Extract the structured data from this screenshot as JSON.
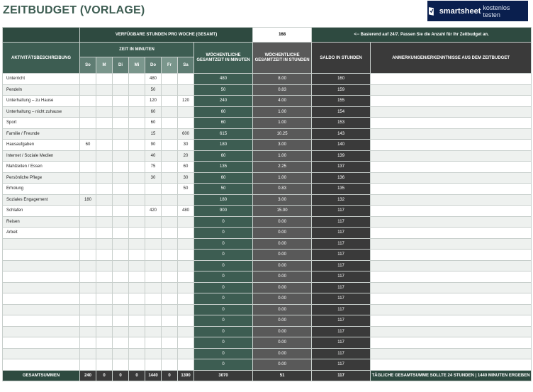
{
  "title": "ZEITBUDGET (VORLAGE)",
  "brand": {
    "name": "smartsheet",
    "cta": "kostenlos testen"
  },
  "header": {
    "available_hours_label": "VERFÜGBARE STUNDEN PRO WOCHE (GESAMT)",
    "available_hours_value": "168",
    "note": "<-- Basierend auf 24/7. Passen Sie die Anzahl für Ihr Zeitbudget an.",
    "activity_col": "AKTIVITÄTSBESCHREIBUNG",
    "minutes_group": "ZEIT IN MINUTEN",
    "days": [
      "So",
      "M",
      "Di",
      "Mi",
      "Do",
      "Fr",
      "Sa"
    ],
    "weekly_minutes": "WÖCHENTLICHE GESAMTZEIT IN MINUTEN",
    "weekly_hours": "WÖCHENTLICHE GESAMTZEIT IN STUNDEN",
    "balance": "SALDO IN STUNDEN",
    "notes_col": "ANMERKUNGEN/ERKENNTNISSE AUS DEM ZEITBUDGET"
  },
  "rows": [
    {
      "activity": "Unterricht",
      "days": [
        "",
        "",
        "",
        "",
        "480",
        "",
        ""
      ],
      "minutes": "480",
      "hours": "8.00",
      "balance": "160"
    },
    {
      "activity": "Pendeln",
      "days": [
        "",
        "",
        "",
        "",
        "50",
        "",
        ""
      ],
      "minutes": "50",
      "hours": "0.83",
      "balance": "159"
    },
    {
      "activity": "Unterhaltung – zu Hause",
      "days": [
        "",
        "",
        "",
        "",
        "120",
        "",
        "120"
      ],
      "minutes": "240",
      "hours": "4.00",
      "balance": "155"
    },
    {
      "activity": "Unterhaltung – nicht zuhause",
      "days": [
        "",
        "",
        "",
        "",
        "60",
        "",
        ""
      ],
      "minutes": "60",
      "hours": "1.00",
      "balance": "154"
    },
    {
      "activity": "Sport",
      "days": [
        "",
        "",
        "",
        "",
        "60",
        "",
        ""
      ],
      "minutes": "60",
      "hours": "1.00",
      "balance": "153"
    },
    {
      "activity": "Familie / Freunde",
      "days": [
        "",
        "",
        "",
        "",
        "15",
        "",
        "600"
      ],
      "minutes": "615",
      "hours": "10.25",
      "balance": "143"
    },
    {
      "activity": "Hausaufgaben",
      "days": [
        "60",
        "",
        "",
        "",
        "90",
        "",
        "30"
      ],
      "minutes": "180",
      "hours": "3.00",
      "balance": "140"
    },
    {
      "activity": "Internet / Soziale Medien",
      "days": [
        "",
        "",
        "",
        "",
        "40",
        "",
        "20"
      ],
      "minutes": "60",
      "hours": "1.00",
      "balance": "139"
    },
    {
      "activity": "Mahlzeiten / Essen",
      "days": [
        "",
        "",
        "",
        "",
        "75",
        "",
        "60"
      ],
      "minutes": "135",
      "hours": "2.25",
      "balance": "137"
    },
    {
      "activity": "Persönliche Pflege",
      "days": [
        "",
        "",
        "",
        "",
        "30",
        "",
        "30"
      ],
      "minutes": "60",
      "hours": "1.00",
      "balance": "136"
    },
    {
      "activity": "Erholung",
      "days": [
        "",
        "",
        "",
        "",
        "",
        "",
        "50"
      ],
      "minutes": "50",
      "hours": "0.83",
      "balance": "135"
    },
    {
      "activity": "Soziales Engagement",
      "days": [
        "180",
        "",
        "",
        "",
        "",
        "",
        ""
      ],
      "minutes": "180",
      "hours": "3.00",
      "balance": "132"
    },
    {
      "activity": "Schlafen",
      "days": [
        "",
        "",
        "",
        "",
        "420",
        "",
        "480"
      ],
      "minutes": "900",
      "hours": "15.00",
      "balance": "117"
    },
    {
      "activity": "Reisen",
      "days": [
        "",
        "",
        "",
        "",
        "",
        "",
        ""
      ],
      "minutes": "0",
      "hours": "0.00",
      "balance": "117"
    },
    {
      "activity": "Arbeit",
      "days": [
        "",
        "",
        "",
        "",
        "",
        "",
        ""
      ],
      "minutes": "0",
      "hours": "0.00",
      "balance": "117"
    },
    {
      "activity": "",
      "days": [
        "",
        "",
        "",
        "",
        "",
        "",
        ""
      ],
      "minutes": "0",
      "hours": "0.00",
      "balance": "117"
    },
    {
      "activity": "",
      "days": [
        "",
        "",
        "",
        "",
        "",
        "",
        ""
      ],
      "minutes": "0",
      "hours": "0.00",
      "balance": "117"
    },
    {
      "activity": "",
      "days": [
        "",
        "",
        "",
        "",
        "",
        "",
        ""
      ],
      "minutes": "0",
      "hours": "0.00",
      "balance": "117"
    },
    {
      "activity": "",
      "days": [
        "",
        "",
        "",
        "",
        "",
        "",
        ""
      ],
      "minutes": "0",
      "hours": "0.00",
      "balance": "117"
    },
    {
      "activity": "",
      "days": [
        "",
        "",
        "",
        "",
        "",
        "",
        ""
      ],
      "minutes": "0",
      "hours": "0.00",
      "balance": "117"
    },
    {
      "activity": "",
      "days": [
        "",
        "",
        "",
        "",
        "",
        "",
        ""
      ],
      "minutes": "0",
      "hours": "0.00",
      "balance": "117"
    },
    {
      "activity": "",
      "days": [
        "",
        "",
        "",
        "",
        "",
        "",
        ""
      ],
      "minutes": "0",
      "hours": "0.00",
      "balance": "117"
    },
    {
      "activity": "",
      "days": [
        "",
        "",
        "",
        "",
        "",
        "",
        ""
      ],
      "minutes": "0",
      "hours": "0.00",
      "balance": "117"
    },
    {
      "activity": "",
      "days": [
        "",
        "",
        "",
        "",
        "",
        "",
        ""
      ],
      "minutes": "0",
      "hours": "0.00",
      "balance": "117"
    },
    {
      "activity": "",
      "days": [
        "",
        "",
        "",
        "",
        "",
        "",
        ""
      ],
      "minutes": "0",
      "hours": "0.00",
      "balance": "117"
    },
    {
      "activity": "",
      "days": [
        "",
        "",
        "",
        "",
        "",
        "",
        ""
      ],
      "minutes": "0",
      "hours": "0.00",
      "balance": "117"
    },
    {
      "activity": "",
      "days": [
        "",
        "",
        "",
        "",
        "",
        "",
        ""
      ],
      "minutes": "0",
      "hours": "0.00",
      "balance": "117"
    }
  ],
  "footer": {
    "label": "GESAMTSUMMEN",
    "days": [
      "240",
      "0",
      "0",
      "0",
      "1440",
      "0",
      "1390"
    ],
    "minutes": "3070",
    "hours": "51",
    "balance": "117",
    "note": "TÄGLICHE GESAMTSUMME SOLLTE 24 STUNDEN | 1440 MINUTEN ERGEBEN"
  }
}
